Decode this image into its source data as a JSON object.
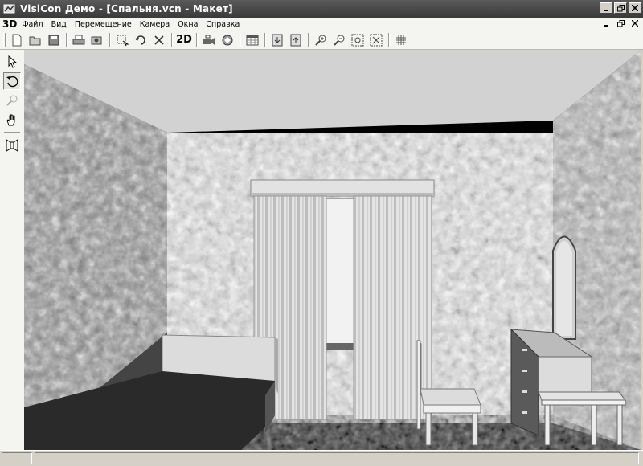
{
  "window": {
    "title": "VisiCon Демо - [Спальня.vcn - Макет]",
    "logo": "3D"
  },
  "menu": {
    "items": [
      "Файл",
      "Вид",
      "Перемещение",
      "Камера",
      "Окна",
      "Справка"
    ]
  },
  "toolbar": {
    "label_2d": "2D",
    "icons": [
      "new-file-icon",
      "open-file-icon",
      "save-icon",
      "print-icon",
      "export-icon",
      "select-icon",
      "undo-icon",
      "delete-icon",
      "view-2d-icon",
      "camera-icon",
      "render-icon",
      "table-icon",
      "import-icon",
      "export-up-icon",
      "zoom-in-icon",
      "zoom-out-icon",
      "zoom-window-icon",
      "zoom-all-icon",
      "grid-icon"
    ]
  },
  "side_tools": {
    "icons": [
      "pointer-icon",
      "rotate-icon",
      "zoom-icon",
      "pan-hand-icon",
      "walls-icon"
    ],
    "active": "rotate-icon"
  },
  "status": {
    "panels": [
      "",
      ""
    ]
  }
}
